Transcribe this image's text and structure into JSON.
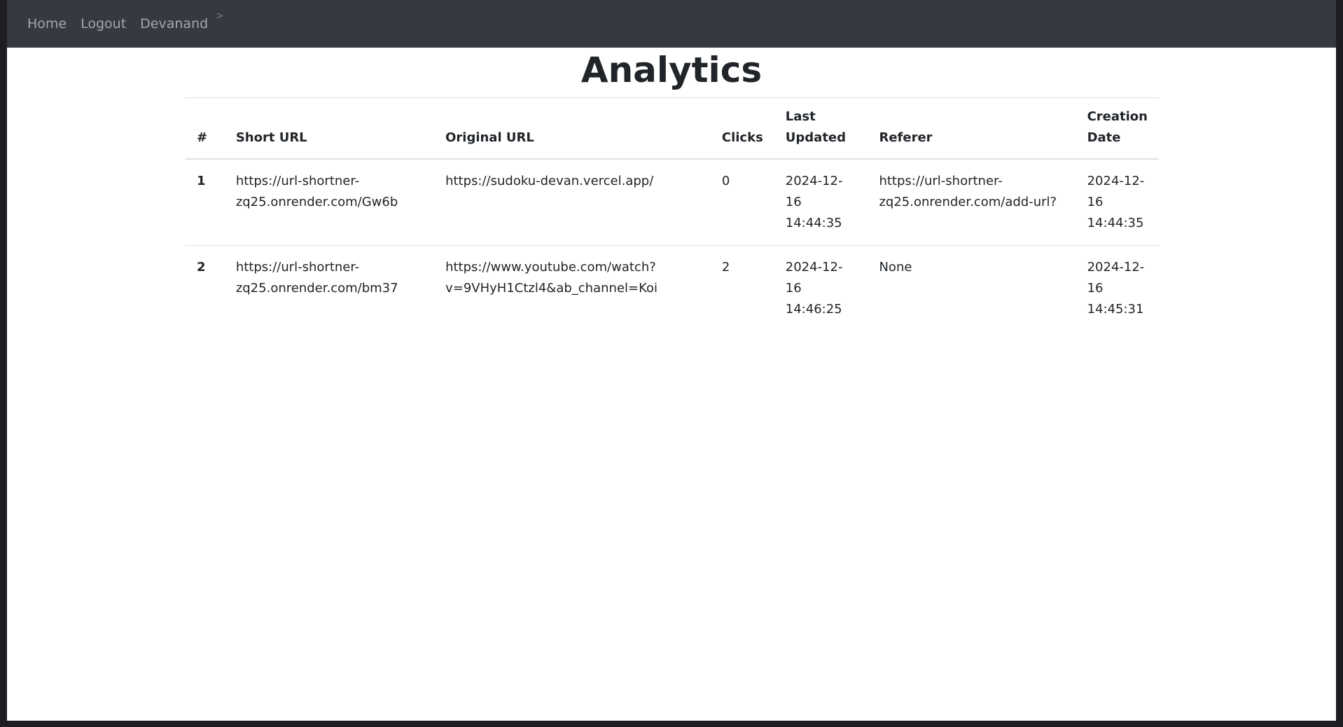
{
  "nav": {
    "home": "Home",
    "logout": "Logout",
    "user": "Devanand",
    "separator": ">"
  },
  "page": {
    "title": "Analytics"
  },
  "table": {
    "headers": {
      "num": "#",
      "short_url": "Short URL",
      "original_url": "Original URL",
      "clicks": "Clicks",
      "last_updated": "Last Updated",
      "referer": "Referer",
      "creation_date": "Creation Date"
    },
    "rows": [
      {
        "num": "1",
        "short_url": "https://url-shortner-zq25.onrender.com/Gw6b",
        "original_url": "https://sudoku-devan.vercel.app/",
        "clicks": "0",
        "last_updated": "2024-12-16 14:44:35",
        "referer": "https://url-shortner-zq25.onrender.com/add-url?",
        "creation_date": "2024-12-16 14:44:35"
      },
      {
        "num": "2",
        "short_url": "https://url-shortner-zq25.onrender.com/bm37",
        "original_url": "https://www.youtube.com/watch?v=9VHyH1Ctzl4&ab_channel=Koi",
        "clicks": "2",
        "last_updated": "2024-12-16 14:46:25",
        "referer": "None",
        "creation_date": "2024-12-16 14:45:31"
      }
    ]
  },
  "colors": {
    "navbar_bg": "#343a40",
    "nav_link": "rgba(255,255,255,0.55)",
    "text": "#212529",
    "border": "#dee2e6"
  }
}
